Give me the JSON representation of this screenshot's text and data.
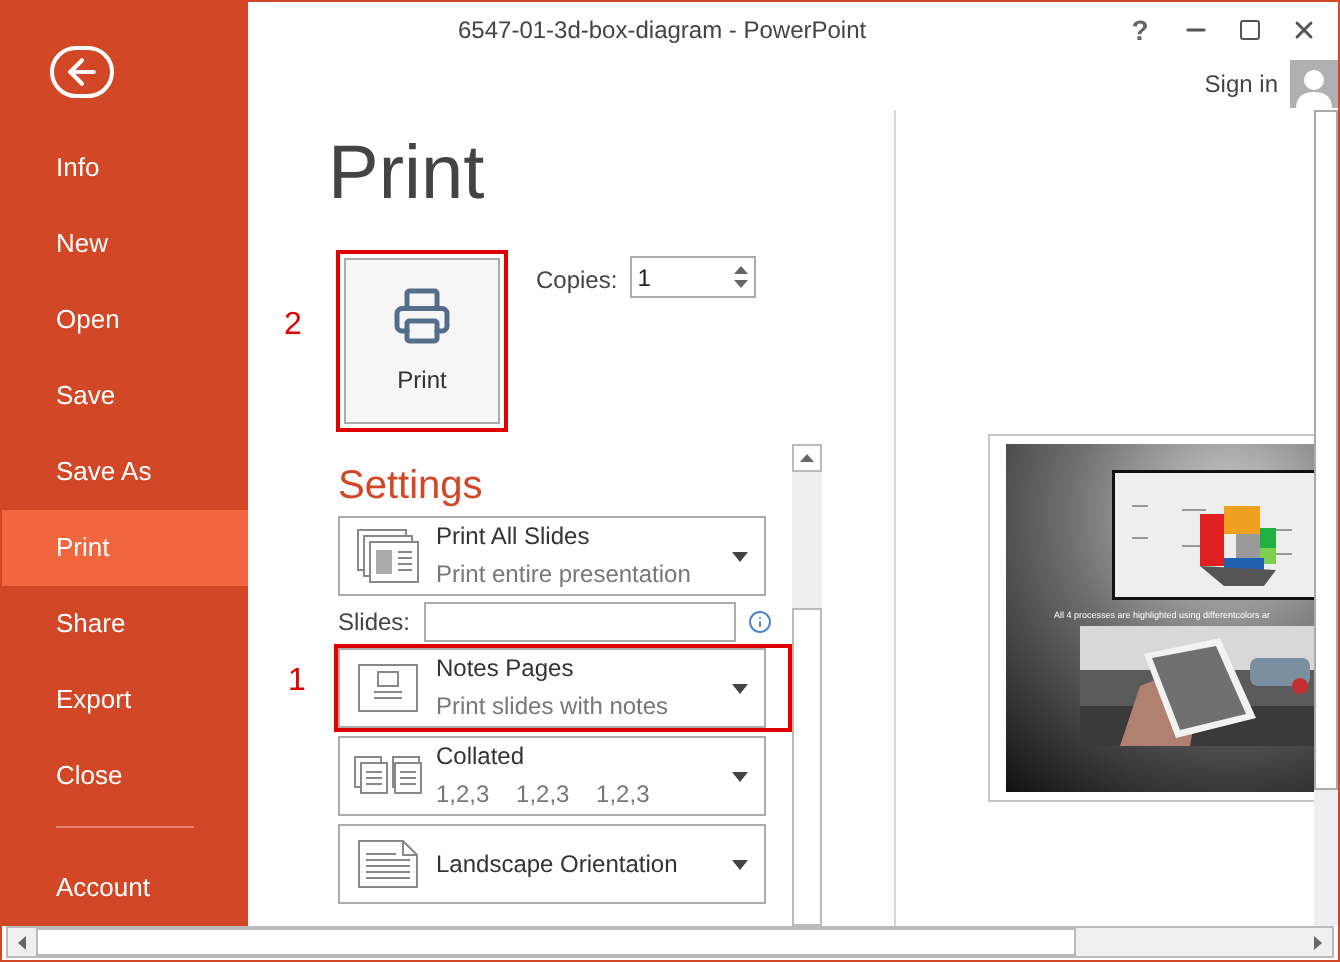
{
  "window": {
    "title": "6547-01-3d-box-diagram - PowerPoint",
    "help": "?",
    "sign_in": "Sign in"
  },
  "sidebar": {
    "items": [
      {
        "label": "Info",
        "selected": false
      },
      {
        "label": "New",
        "selected": false
      },
      {
        "label": "Open",
        "selected": false
      },
      {
        "label": "Save",
        "selected": false
      },
      {
        "label": "Save As",
        "selected": false
      },
      {
        "label": "Print",
        "selected": true
      },
      {
        "label": "Share",
        "selected": false
      },
      {
        "label": "Export",
        "selected": false
      },
      {
        "label": "Close",
        "selected": false
      }
    ],
    "footer_items": [
      {
        "label": "Account",
        "selected": false
      }
    ]
  },
  "print": {
    "heading": "Print",
    "button": {
      "label": "Print",
      "annotation": "2"
    },
    "copies": {
      "label": "Copies:",
      "value": "1"
    }
  },
  "settings": {
    "heading": "Settings",
    "slides_label": "Slides:",
    "items": [
      {
        "kind": "all-slides",
        "title": "Print All Slides",
        "subtitle": "Print entire presentation"
      },
      {
        "kind": "notes",
        "title": "Notes Pages",
        "subtitle": "Print slides with notes",
        "annotation": "1"
      },
      {
        "kind": "collated",
        "title": "Collated",
        "subtitle": "1,2,3    1,2,3    1,2,3"
      },
      {
        "kind": "orientation",
        "title": "Landscape Orientation"
      }
    ]
  },
  "preview": {
    "caption": "All 4 processes are highlighted using differentcolors ar"
  }
}
